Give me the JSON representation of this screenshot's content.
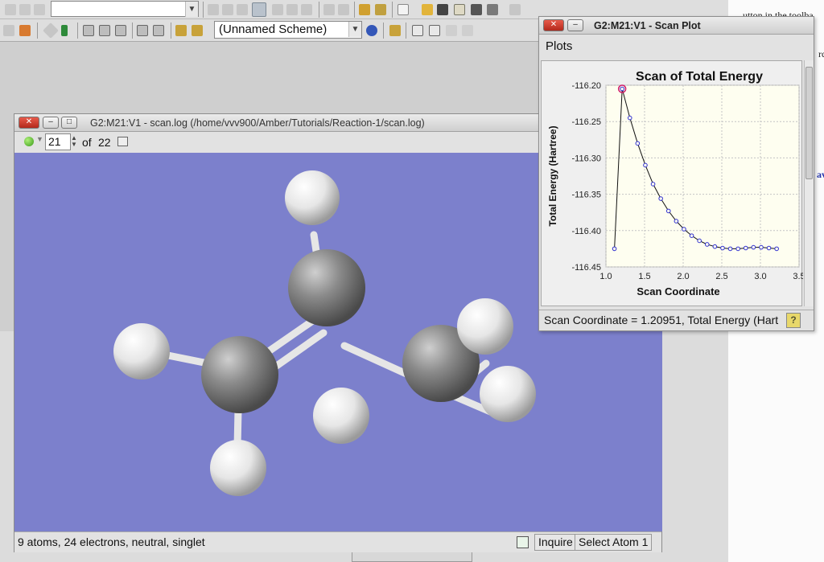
{
  "main_toolbar": {
    "scheme_select": {
      "value": "(Unnamed Scheme)"
    }
  },
  "document_bg": {
    "line1": "utton in the toolba",
    "line2": "rcs",
    "line3": "ave"
  },
  "viewer": {
    "title": "G2:M21:V1 - scan.log (/home/vvv900/Amber/Tutorials/Reaction-1/scan.log)",
    "frame": {
      "current": "21",
      "of_label": "of",
      "total": "22"
    },
    "status": {
      "info": "9 atoms, 24 electrons, neutral, singlet",
      "mode1": "Inquire",
      "mode2": "Select Atom 1"
    },
    "colors": {
      "background": "#7c80cc",
      "carbon": "#6e6e6e",
      "hydrogen": "#f2f2f2"
    }
  },
  "plot_window": {
    "title": "G2:M21:V1 - Scan Plot",
    "menu": {
      "plots": "Plots"
    },
    "status_text": "Scan Coordinate = 1.20951, Total Energy (Hart",
    "help_icon": "question-icon"
  },
  "chart_data": {
    "type": "line",
    "title": "Scan of Total Energy",
    "xlabel": "Scan Coordinate",
    "ylabel": "Total Energy (Hartree)",
    "xlim": [
      1.0,
      3.5
    ],
    "ylim": [
      -116.45,
      -116.2
    ],
    "xticks": [
      "1.0",
      "1.5",
      "2.0",
      "2.5",
      "3.0",
      "3.5"
    ],
    "yticks": [
      "-116.20",
      "-116.25",
      "-116.30",
      "-116.35",
      "-116.40",
      "-116.45"
    ],
    "grid": true,
    "series": [
      {
        "x": [
          1.11,
          1.21,
          1.31,
          1.41,
          1.51,
          1.61,
          1.71,
          1.81,
          1.91,
          2.01,
          2.11,
          2.21,
          2.31,
          2.41,
          2.51,
          2.61,
          2.71,
          2.81,
          2.91,
          3.01,
          3.11,
          3.21
        ],
        "y": [
          -116.425,
          -116.205,
          -116.245,
          -116.28,
          -116.31,
          -116.336,
          -116.356,
          -116.373,
          -116.387,
          -116.398,
          -116.407,
          -116.414,
          -116.419,
          -116.422,
          -116.424,
          -116.425,
          -116.425,
          -116.424,
          -116.423,
          -116.423,
          -116.424,
          -116.425
        ]
      }
    ],
    "highlight_index": 1,
    "colors": {
      "line": "#111111",
      "marker": "#2f2fd0",
      "highlight": "#d01b6a",
      "plot_bg": "#fefef0"
    }
  }
}
